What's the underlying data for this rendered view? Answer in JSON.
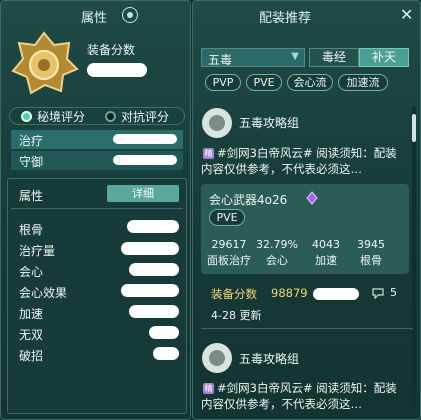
{
  "left": {
    "title": "属性",
    "score_label": "装备分数",
    "eval_options": [
      "秘境评分",
      "对抗评分"
    ],
    "roles": [
      "治疗",
      "守御"
    ],
    "attr_header": "属性",
    "detail_btn": "详细",
    "attributes": [
      "根骨",
      "治疗量",
      "会心",
      "会心效果",
      "加速",
      "无双",
      "破招"
    ]
  },
  "right": {
    "title": "配装推荐",
    "school_select": "五毒",
    "school_tabs": [
      "毒经",
      "补天"
    ],
    "filter_tags": [
      "PVP",
      "PVE",
      "会心流",
      "加速流"
    ],
    "posts": [
      {
        "author": "五毒攻略组",
        "badge": "精",
        "text": "#剑网3白帝风云# 阅读须知：配装内容仅供参考，不代表必须这…"
      },
      {
        "author": "五毒攻略组",
        "badge": "精",
        "text": "#剑网3白帝风云# 阅读须知：配装内容仅供参考，不代表必须这…"
      }
    ],
    "card": {
      "name": "会心武器4o26",
      "tag": "PVE",
      "stats": [
        {
          "value": "29617",
          "label": "面板治疗"
        },
        {
          "value": "32.79%",
          "label": "会心"
        },
        {
          "value": "4043",
          "label": "加速"
        },
        {
          "value": "3945",
          "label": "根骨"
        }
      ]
    },
    "score_label": "装备分数",
    "score_value": "98879",
    "comment_count": "5",
    "update_text": "4-28 更新"
  },
  "colors": {
    "panel": "#1b4440",
    "accent": "#2e6e6c",
    "gold": "#f5d57a",
    "card": "#2b5c56"
  }
}
